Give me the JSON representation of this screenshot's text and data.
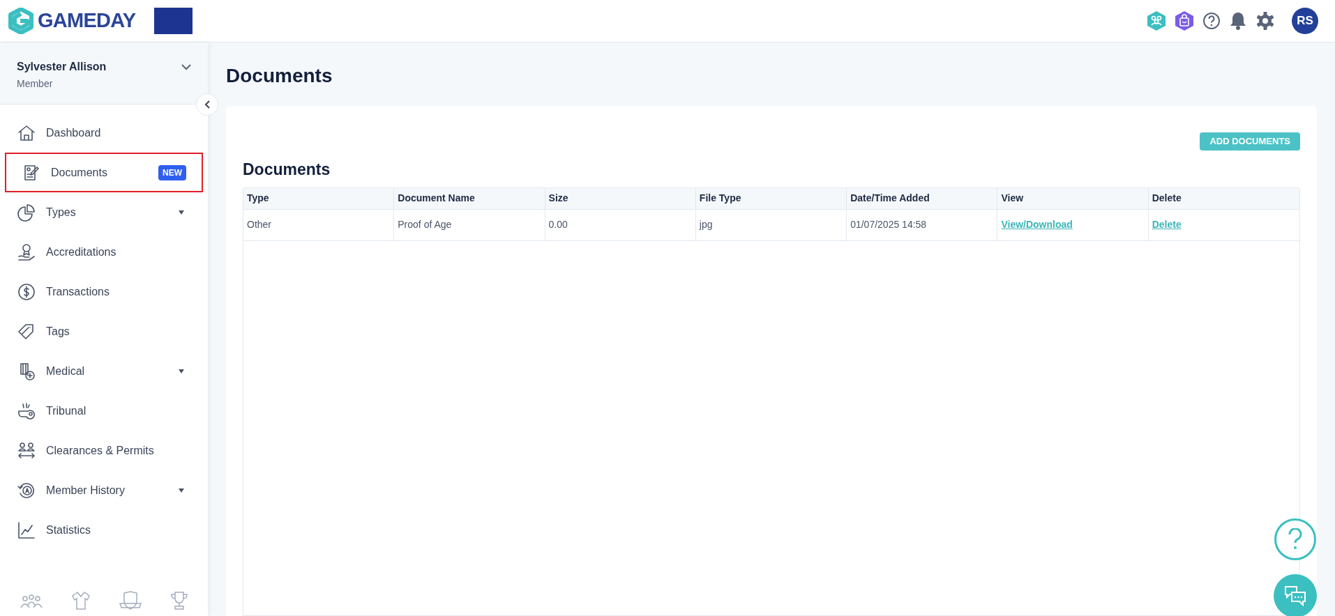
{
  "header": {
    "logo_text": "GAMEDAY",
    "avatar_initials": "RS"
  },
  "user": {
    "name": "Sylvester Allison",
    "role": "Member"
  },
  "sidebar": {
    "items": [
      {
        "label": "Dashboard",
        "highlighted": false,
        "has_submenu": false
      },
      {
        "label": "Documents",
        "highlighted": true,
        "has_submenu": false,
        "badge": "NEW"
      },
      {
        "label": "Types",
        "highlighted": false,
        "has_submenu": true
      },
      {
        "label": "Accreditations",
        "highlighted": false,
        "has_submenu": false
      },
      {
        "label": "Transactions",
        "highlighted": false,
        "has_submenu": false
      },
      {
        "label": "Tags",
        "highlighted": false,
        "has_submenu": false
      },
      {
        "label": "Medical",
        "highlighted": false,
        "has_submenu": true
      },
      {
        "label": "Tribunal",
        "highlighted": false,
        "has_submenu": false
      },
      {
        "label": "Clearances & Permits",
        "highlighted": false,
        "has_submenu": false
      },
      {
        "label": "Member History",
        "highlighted": false,
        "has_submenu": true
      },
      {
        "label": "Statistics",
        "highlighted": false,
        "has_submenu": false
      }
    ]
  },
  "page": {
    "title": "Documents"
  },
  "panel": {
    "add_button": "ADD DOCUMENTS",
    "title": "Documents",
    "table": {
      "columns": [
        "Type",
        "Document Name",
        "Size",
        "File Type",
        "Date/Time Added",
        "View",
        "Delete"
      ],
      "rows": [
        {
          "type": "Other",
          "name": "Proof of Age",
          "size": "0.00",
          "file_type": "jpg",
          "added": "01/07/2025 14:58",
          "view": "View/Download",
          "delete": "Delete"
        }
      ]
    }
  }
}
